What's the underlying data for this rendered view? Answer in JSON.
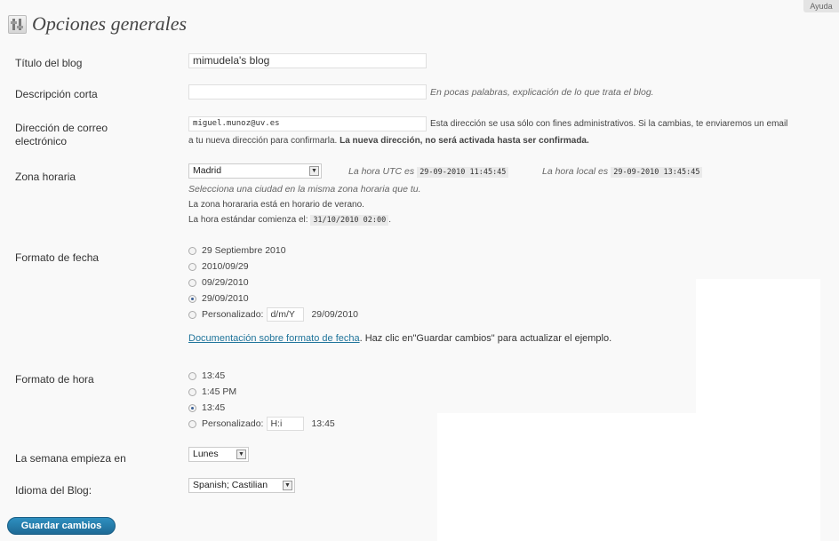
{
  "header": {
    "title": "Opciones generales",
    "help_label": "Ayuda"
  },
  "blog_title": {
    "label": "Título del blog",
    "value": "mimudela's blog"
  },
  "tagline": {
    "label": "Descripción corta",
    "value": "",
    "description": "En pocas palabras, explicación de lo que trata el blog."
  },
  "email": {
    "label_line1": "Dirección de correo",
    "label_line2": "electrónico",
    "value": "miguel.munoz@uv.es",
    "description_1": "Esta dirección se usa sólo con fines administrativos. Si la cambias, te enviaremos un email",
    "description_2a": "a tu nueva dirección para confirmarla.",
    "description_2b": "La nueva dirección, no será activada hasta ser confirmada."
  },
  "timezone": {
    "label": "Zona horaria",
    "selected": "Madrid",
    "utc_label": "La hora UTC es",
    "utc_value": "29-09-2010 11:45:45",
    "local_label": "La hora local es",
    "local_value": "29-09-2010 13:45:45",
    "hint": "Selecciona una ciudad en la misma zona horaria que tu.",
    "dst_note": "La zona horararia está en horario de verano.",
    "std_label": "La hora estándar comienza el:",
    "std_value": "31/10/2010 02:00",
    "std_suffix": "."
  },
  "date_format": {
    "label": "Formato de fecha",
    "options": [
      {
        "label": "29 Septiembre 2010",
        "checked": false
      },
      {
        "label": "2010/09/29",
        "checked": false
      },
      {
        "label": "09/29/2010",
        "checked": false
      },
      {
        "label": "29/09/2010",
        "checked": true
      }
    ],
    "custom_label": "Personalizado:",
    "custom_value": "d/m/Y",
    "custom_preview": "29/09/2010",
    "doc_link": "Documentación sobre formato de fecha",
    "doc_suffix": ". Haz clic en\"Guardar cambios\" para actualizar el ejemplo."
  },
  "time_format": {
    "label": "Formato de hora",
    "options": [
      {
        "label": "13:45",
        "checked": false
      },
      {
        "label": "1:45 PM",
        "checked": false
      },
      {
        "label": "13:45",
        "checked": true
      }
    ],
    "custom_label": "Personalizado:",
    "custom_value": "H:i",
    "custom_preview": "13:45"
  },
  "week_start": {
    "label": "La semana empieza en",
    "selected": "Lunes"
  },
  "language": {
    "label": "Idioma del Blog:",
    "selected": "Spanish; Castilian"
  },
  "save_button": {
    "label": "Guardar cambios"
  },
  "colors": {
    "accent": "#21759b",
    "link": "#21759b"
  }
}
